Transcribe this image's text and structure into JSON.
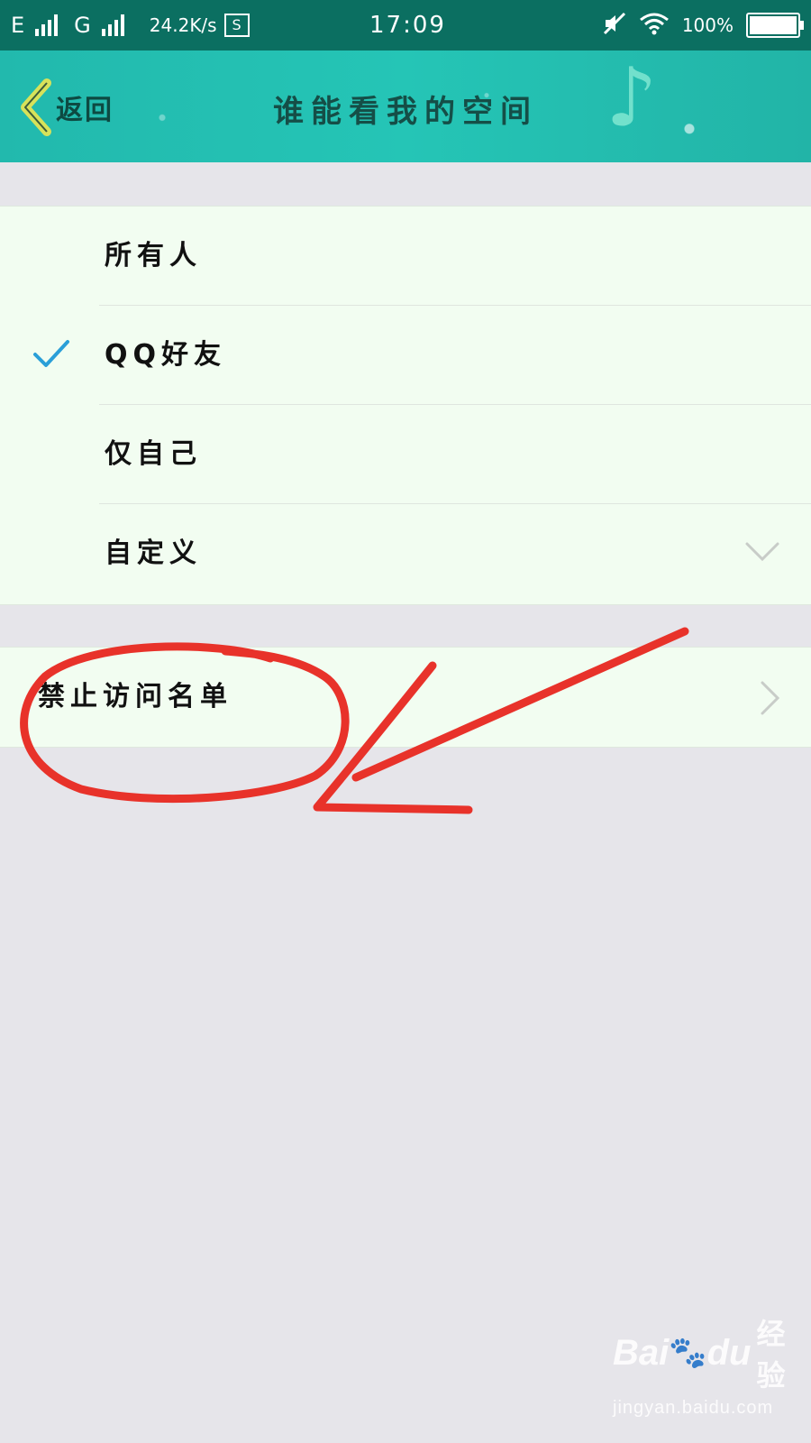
{
  "status_bar": {
    "network1": "E",
    "network2": "G",
    "speed": "24.2K/s",
    "s_icon": "S",
    "time": "17:09",
    "battery": "100%",
    "icons": [
      "signal-icon",
      "signal-icon",
      "screenshot-icon",
      "mute-icon",
      "wifi-icon",
      "battery-icon"
    ]
  },
  "header": {
    "back_label": "返回",
    "title": "谁能看我的空间"
  },
  "options": [
    {
      "label": "所有人",
      "selected": false
    },
    {
      "label": "QQ好友",
      "selected": true
    },
    {
      "label": "仅自己",
      "selected": false
    },
    {
      "label": "自定义",
      "selected": false,
      "expandable": true
    }
  ],
  "block_list": {
    "label": "禁止访问名单"
  },
  "colors": {
    "status_bar": "#0b6f61",
    "header": "#25c5b6",
    "check": "#2a9fd8",
    "list_bg": "#f2fdf1",
    "page_bg": "#e6e5ea",
    "annotation": "#e8322a"
  },
  "watermark": {
    "brand": "Bai",
    "brand2": "du",
    "suffix": "经验",
    "url": "jingyan.baidu.com"
  }
}
